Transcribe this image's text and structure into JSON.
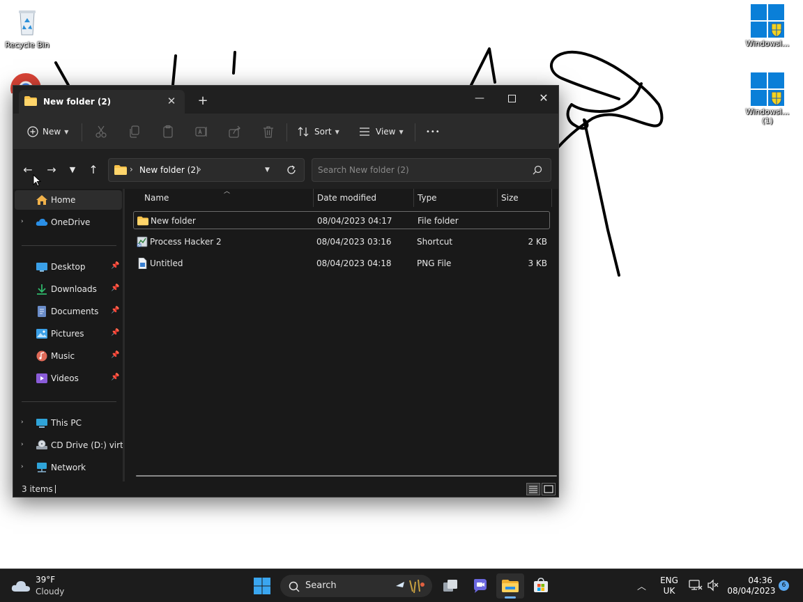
{
  "desktop": {
    "icons": [
      {
        "label": "Recycle Bin"
      },
      {
        "label": "WindowsI..."
      },
      {
        "label": "WindowsI...\n(1)"
      }
    ]
  },
  "explorer": {
    "tab_title": "New folder (2)",
    "toolbar": {
      "new_label": "New",
      "sort_label": "Sort",
      "view_label": "View",
      "more_label": "•••"
    },
    "address": {
      "crumb": "New folder (2)"
    },
    "search": {
      "placeholder": "Search New folder (2)"
    },
    "nav": {
      "home": "Home",
      "onedrive": "OneDrive",
      "desktop": "Desktop",
      "downloads": "Downloads",
      "documents": "Documents",
      "pictures": "Pictures",
      "music": "Music",
      "videos": "Videos",
      "thispc": "This PC",
      "cddrive": "CD Drive (D:) virtio-",
      "network": "Network"
    },
    "columns": {
      "name": "Name",
      "date": "Date modified",
      "type": "Type",
      "size": "Size"
    },
    "files": [
      {
        "name": "New folder",
        "date": "08/04/2023 04:17",
        "type": "File folder",
        "size": ""
      },
      {
        "name": "Process Hacker 2",
        "date": "08/04/2023 03:16",
        "type": "Shortcut",
        "size": "2 KB"
      },
      {
        "name": "Untitled",
        "date": "08/04/2023 04:18",
        "type": "PNG File",
        "size": "3 KB"
      }
    ],
    "status": {
      "count": "3 items"
    }
  },
  "taskbar": {
    "weather": {
      "temp": "39°F",
      "condition": "Cloudy"
    },
    "search_label": "Search",
    "lang": {
      "line1": "ENG",
      "line2": "UK"
    },
    "clock": {
      "time": "04:36",
      "date": "08/04/2023"
    },
    "notification_count": "6"
  },
  "colors": {
    "accent": "#4cc2ff",
    "folder": "#f8c24a",
    "windows_blue": "#0078d4"
  }
}
